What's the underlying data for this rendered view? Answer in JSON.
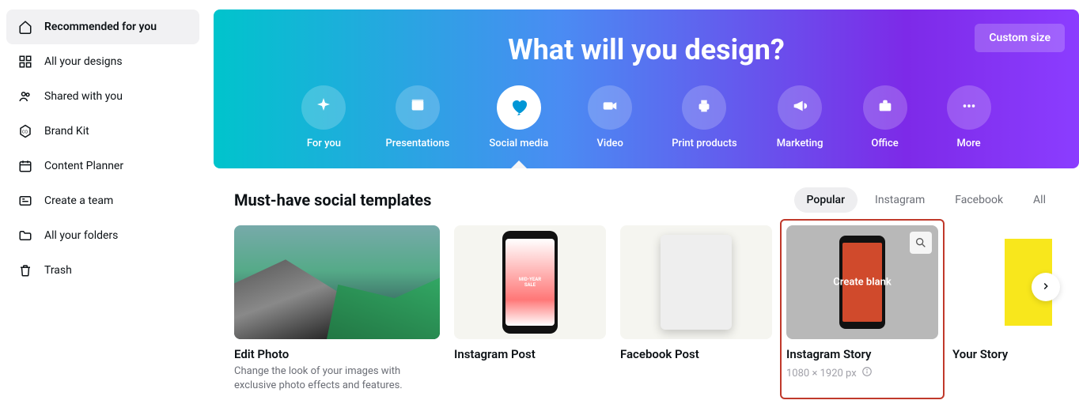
{
  "sidebar": {
    "items": [
      {
        "label": "Recommended for you",
        "icon": "home"
      },
      {
        "label": "All your designs",
        "icon": "grid"
      },
      {
        "label": "Shared with you",
        "icon": "people"
      },
      {
        "label": "Brand Kit",
        "icon": "brand"
      },
      {
        "label": "Content Planner",
        "icon": "calendar"
      },
      {
        "label": "Create a team",
        "icon": "team"
      },
      {
        "label": "All your folders",
        "icon": "folder"
      },
      {
        "label": "Trash",
        "icon": "trash"
      }
    ]
  },
  "hero": {
    "title": "What will you design?",
    "custom_size": "Custom size",
    "categories": [
      {
        "label": "For you",
        "icon": "sparkle"
      },
      {
        "label": "Presentations",
        "icon": "presentation"
      },
      {
        "label": "Social media",
        "icon": "heart"
      },
      {
        "label": "Video",
        "icon": "video"
      },
      {
        "label": "Print products",
        "icon": "print"
      },
      {
        "label": "Marketing",
        "icon": "megaphone"
      },
      {
        "label": "Office",
        "icon": "briefcase"
      },
      {
        "label": "More",
        "icon": "dots"
      }
    ],
    "active_category": 2
  },
  "section": {
    "title": "Must-have social templates",
    "filters": [
      "Popular",
      "Instagram",
      "Facebook",
      "All"
    ],
    "active_filter": 0,
    "templates": [
      {
        "title": "Edit Photo",
        "subtitle": "Change the look of your images with exclusive photo effects and features."
      },
      {
        "title": "Instagram Post"
      },
      {
        "title": "Facebook Post"
      },
      {
        "title": "Instagram Story",
        "dimensions": "1080 × 1920 px",
        "create_blank": "Create blank"
      },
      {
        "title": "Your Story"
      }
    ]
  }
}
